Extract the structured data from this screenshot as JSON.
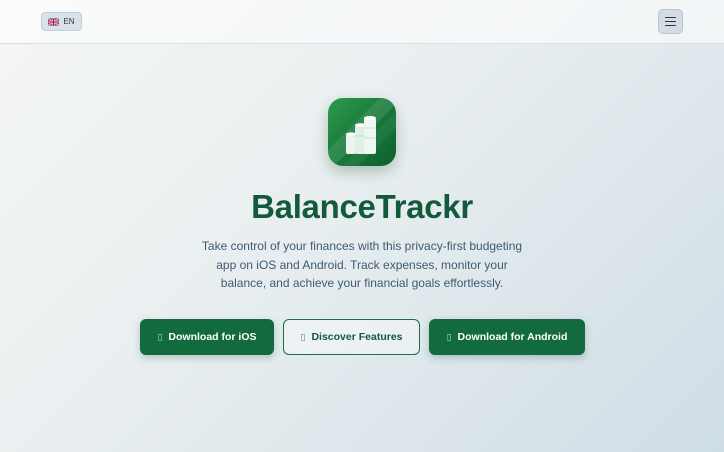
{
  "header": {
    "language_label": "EN",
    "language_flag": "uk-flag-icon",
    "menu_icon": "hamburger-menu-icon"
  },
  "hero": {
    "app_icon": "balance-chart-app-icon",
    "title": "BalanceTrackr",
    "description": "Take control of your finances with this privacy-first budgeting app on iOS and Android. Track expenses, monitor your balance, and achieve your financial goals effortlessly."
  },
  "actions": {
    "ios_label": "Download for iOS",
    "features_label": "Discover Features",
    "android_label": "Download for Android",
    "icon_glyph": "▯"
  },
  "colors": {
    "brand_green": "#136a3f",
    "title_green": "#135a3d",
    "text_blue": "#3d5a73"
  }
}
